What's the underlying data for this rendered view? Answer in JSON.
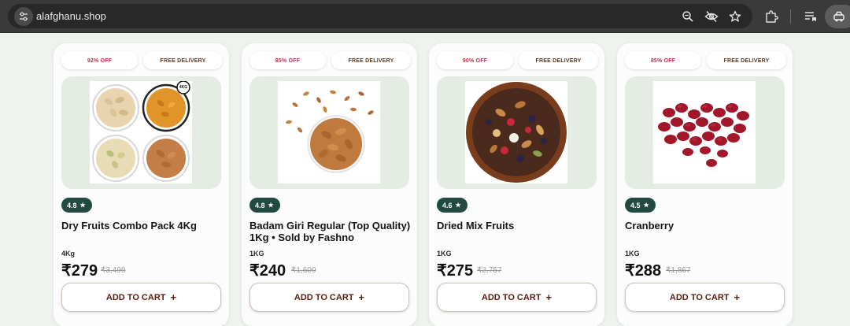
{
  "browser": {
    "url": "alafghanu.shop",
    "icons": {
      "site_info": "tune-icon",
      "zoom": "zoom-icon",
      "eye_off": "eye-off-icon",
      "bookmark": "star-icon",
      "extensions": "puzzle-icon",
      "reading_list": "reading-list-icon",
      "profile": "profile-icon"
    }
  },
  "colors": {
    "rating_badge": "#234a40",
    "discount_text": "#b3324a",
    "cart_text": "#5a1c0e",
    "page_background": "#eef3ee"
  },
  "products": [
    {
      "discount": "92% OFF",
      "delivery": "FREE DELIVERY",
      "rating": "4.8",
      "title": "Dry Fruits Combo Pack 4Kg",
      "weight": "4Kg",
      "price": "₹279",
      "mrp": "₹3,499",
      "cart_label": "ADD TO CART",
      "cart_icon": "+",
      "image_badge": "4KG",
      "image": "dry-fruits-combo-image"
    },
    {
      "discount": "85% OFF",
      "delivery": "FREE DELIVERY",
      "rating": "4.8",
      "title": "Badam Giri Regular (Top Quality) 1Kg • Sold by Fashno",
      "weight": "1KG",
      "price": "₹240",
      "mrp": "₹1,600",
      "cart_label": "ADD TO CART",
      "cart_icon": "+",
      "image": "almonds-image"
    },
    {
      "discount": "90% OFF",
      "delivery": "FREE DELIVERY",
      "rating": "4.6",
      "title": "Dried Mix Fruits",
      "weight": "1KG",
      "price": "₹275",
      "mrp": "₹2,757",
      "cart_label": "ADD TO CART",
      "cart_icon": "+",
      "image": "mixed-dried-fruits-image"
    },
    {
      "discount": "85% OFF",
      "delivery": "FREE DELIVERY",
      "rating": "4.5",
      "title": "Cranberry",
      "weight": "1KG",
      "price": "₹288",
      "mrp": "₹1,867",
      "cart_label": "ADD TO CART",
      "cart_icon": "+",
      "image": "cranberry-image"
    }
  ]
}
